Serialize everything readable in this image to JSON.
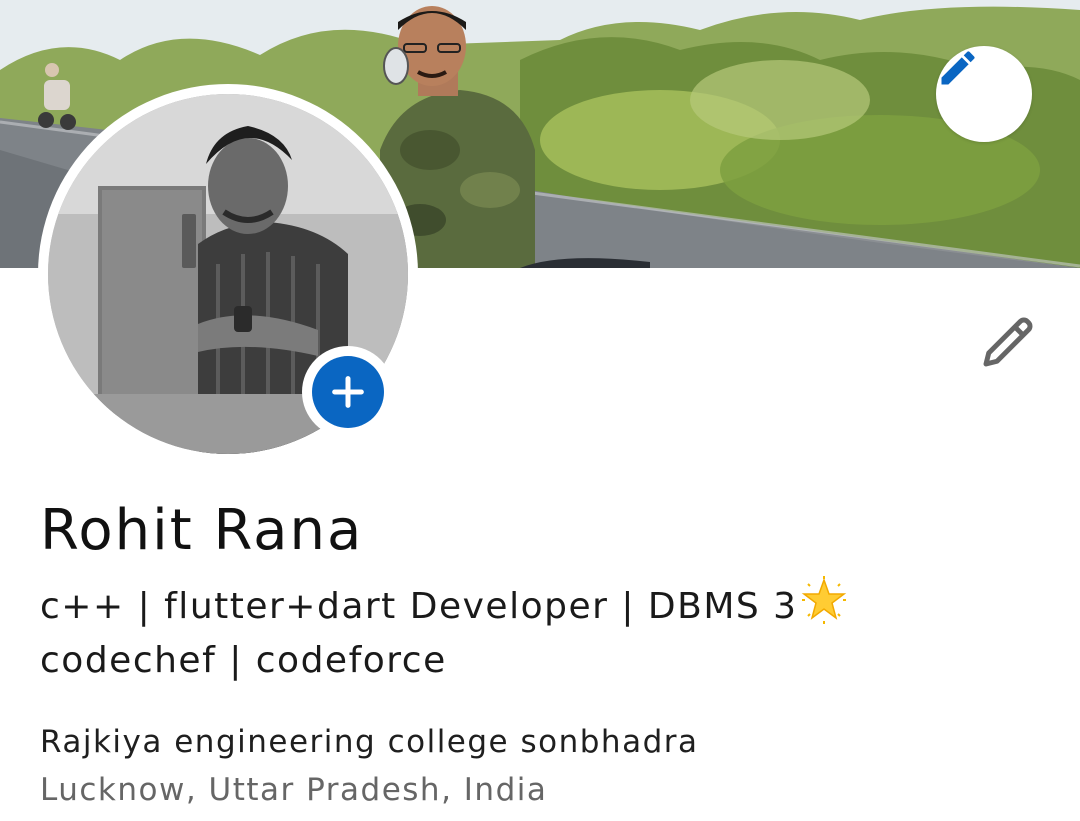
{
  "profile": {
    "name": "Rohit Rana",
    "headline_line1": "c++ | flutter+dart Developer | DBMS 3",
    "headline_line2": "codechef | codeforce",
    "headline_emoji": "glowing-star",
    "education": "Rajkiya engineering college sonbhadra",
    "location": "Lucknow, Uttar Pradesh, India"
  },
  "icons": {
    "cover_edit": "pencil-icon",
    "add_photo": "plus-icon",
    "intro_edit": "pencil-icon"
  },
  "colors": {
    "accent_blue": "#0a66c2",
    "text_primary": "#111111",
    "text_secondary": "#666666",
    "icon_gray": "#666666"
  }
}
